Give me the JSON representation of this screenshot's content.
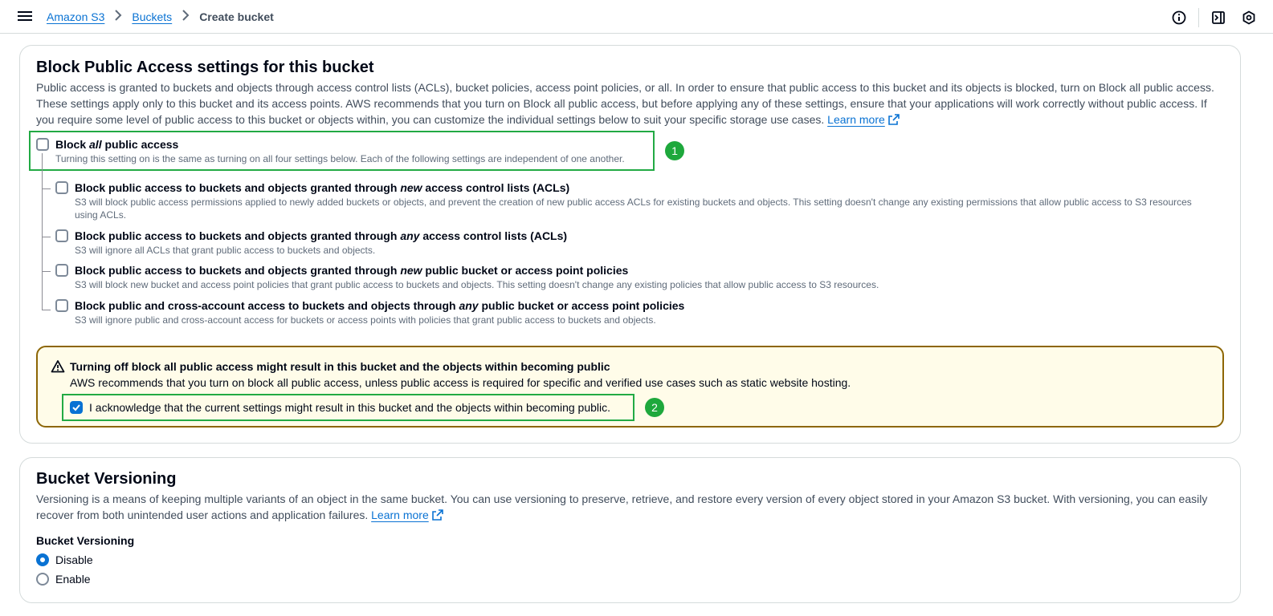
{
  "breadcrumb": {
    "items": [
      "Amazon S3",
      "Buckets"
    ],
    "current": "Create bucket"
  },
  "block_public_access": {
    "title": "Block Public Access settings for this bucket",
    "description": "Public access is granted to buckets and objects through access control lists (ACLs), bucket policies, access point policies, or all. In order to ensure that public access to this bucket and its objects is blocked, turn on Block all public access. These settings apply only to this bucket and its access points. AWS recommends that you turn on Block all public access, but before applying any of these settings, ensure that your applications will work correctly without public access. If you require some level of public access to this bucket or objects within, you can customize the individual settings below to suit your specific storage use cases.",
    "learn_more": "Learn more",
    "block_all": {
      "title_pre": "Block ",
      "title_em": "all",
      "title_post": " public access",
      "description": "Turning this setting on is the same as turning on all four settings below. Each of the following settings are independent of one another.",
      "checked": false,
      "badge": "1"
    },
    "options": [
      {
        "title_pre": "Block public access to buckets and objects granted through ",
        "title_em": "new",
        "title_post": " access control lists (ACLs)",
        "description": "S3 will block public access permissions applied to newly added buckets or objects, and prevent the creation of new public access ACLs for existing buckets and objects. This setting doesn't change any existing permissions that allow public access to S3 resources using ACLs.",
        "checked": false
      },
      {
        "title_pre": "Block public access to buckets and objects granted through ",
        "title_em": "any",
        "title_post": " access control lists (ACLs)",
        "description": "S3 will ignore all ACLs that grant public access to buckets and objects.",
        "checked": false
      },
      {
        "title_pre": "Block public access to buckets and objects granted through ",
        "title_em": "new",
        "title_post": " public bucket or access point policies",
        "description": "S3 will block new bucket and access point policies that grant public access to buckets and objects. This setting doesn't change any existing policies that allow public access to S3 resources.",
        "checked": false
      },
      {
        "title_pre": "Block public and cross-account access to buckets and objects through ",
        "title_em": "any",
        "title_post": " public bucket or access point policies",
        "description": "S3 will ignore public and cross-account access for buckets or access points with policies that grant public access to buckets and objects.",
        "checked": false
      }
    ],
    "warning": {
      "title": "Turning off block all public access might result in this bucket and the objects within becoming public",
      "text": "AWS recommends that you turn on block all public access, unless public access is required for specific and verified use cases such as static website hosting.",
      "acknowledge_label": "I acknowledge that the current settings might result in this bucket and the objects within becoming public.",
      "acknowledged": true,
      "badge": "2"
    }
  },
  "versioning": {
    "title": "Bucket Versioning",
    "description": "Versioning is a means of keeping multiple variants of an object in the same bucket. You can use versioning to preserve, retrieve, and restore every version of every object stored in your Amazon S3 bucket. With versioning, you can easily recover from both unintended user actions and application failures.",
    "learn_more": "Learn more",
    "field_label": "Bucket Versioning",
    "options": [
      {
        "label": "Disable",
        "selected": true
      },
      {
        "label": "Enable",
        "selected": false
      }
    ]
  },
  "colors": {
    "link": "#0972d3",
    "highlight": "#22aa44",
    "warning_border": "#8d6605",
    "warning_bg": "#fffce9"
  }
}
